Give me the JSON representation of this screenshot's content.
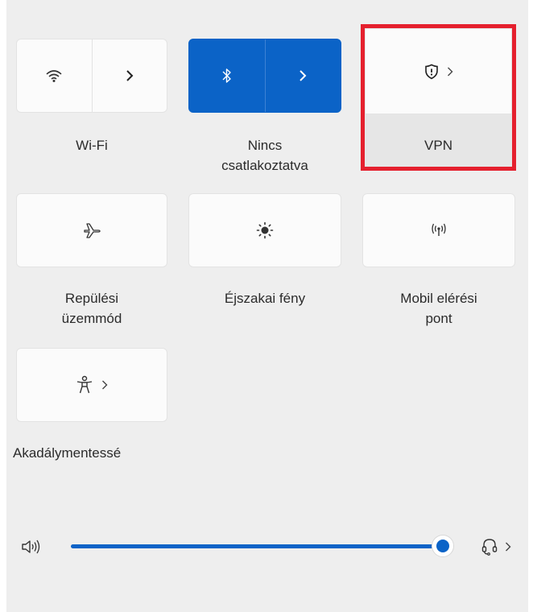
{
  "tiles": {
    "wifi": {
      "label": "Wi-Fi"
    },
    "bluetooth": {
      "label_line1": "Nincs",
      "label_line2": "csatlakoztatva"
    },
    "vpn": {
      "label": "VPN"
    },
    "airplane": {
      "label_line1": "Repülési",
      "label_line2": "üzemmód"
    },
    "night_light": {
      "label": "Éjszakai fény"
    },
    "hotspot": {
      "label_line1": "Mobil elérési",
      "label_line2": "pont"
    },
    "accessibility": {
      "label": "Akadálymentessé"
    }
  },
  "volume": {
    "level_percent": 100
  },
  "colors": {
    "accent": "#0b63c7",
    "highlight": "#e5202e"
  },
  "icons": [
    "wifi-icon",
    "chevron-right-icon",
    "bluetooth-icon",
    "shield-icon",
    "airplane-icon",
    "brightness-icon",
    "hotspot-icon",
    "accessibility-icon",
    "speaker-icon",
    "headset-icon"
  ]
}
